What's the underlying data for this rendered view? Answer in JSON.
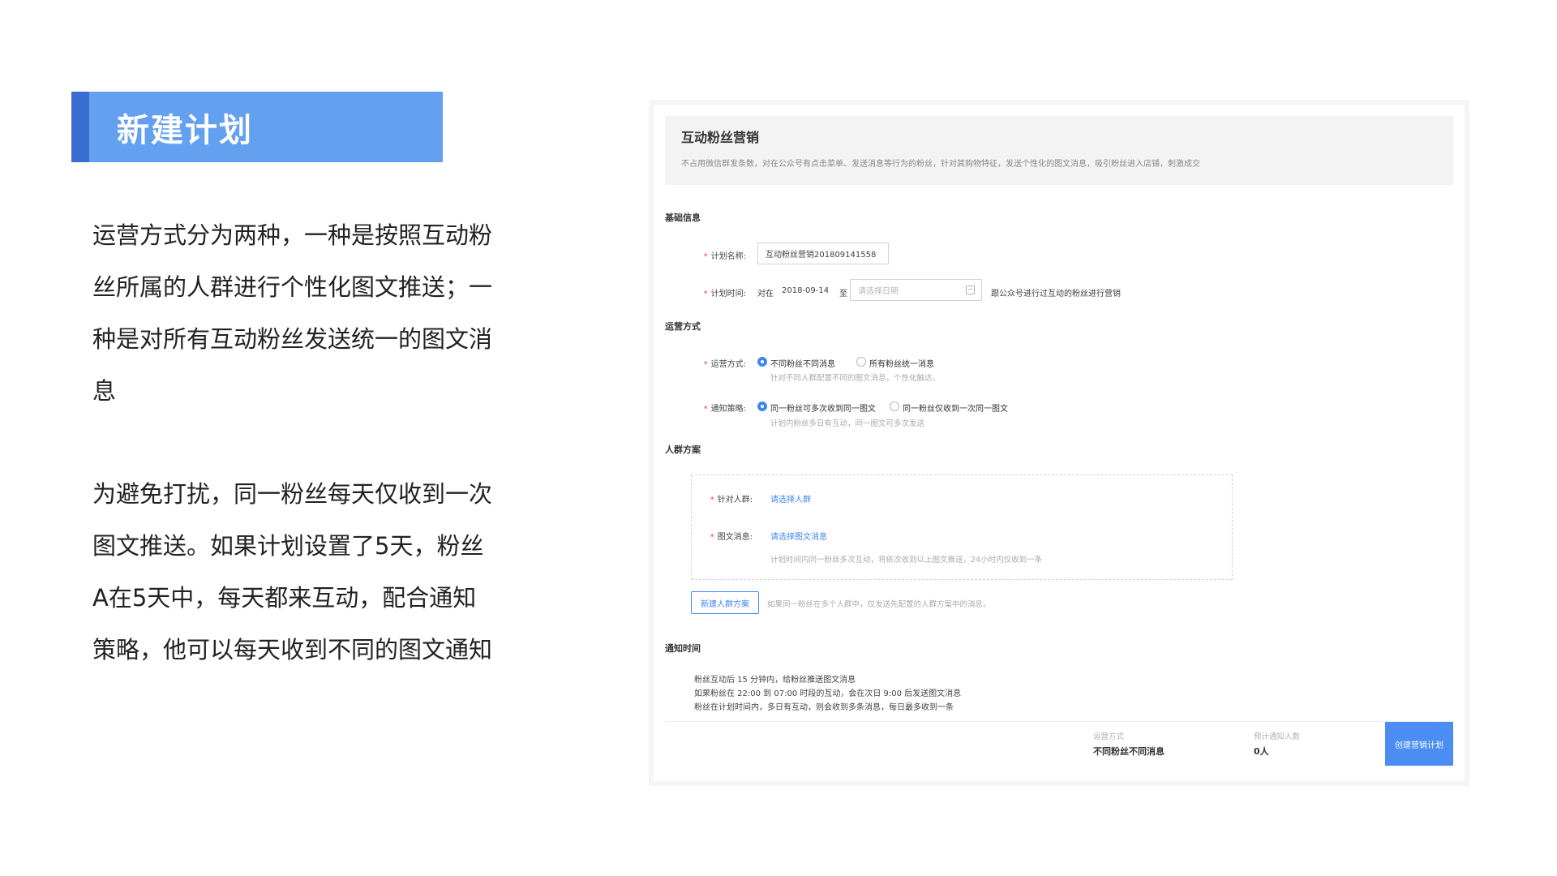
{
  "slide": {
    "title": "新建计划",
    "paragraph1_lines": [
      "运营方式分为两种，一种是按照互动粉",
      "丝所属的人群进行个性化图文推送；一",
      "种是对所有互动粉丝发送统一的图文消",
      "息"
    ],
    "paragraph2_lines": [
      "为避免打扰，同一粉丝每天仅收到一次",
      "图文推送。如果计划设置了5天，粉丝",
      "A在5天中，每天都来互动，配合通知",
      "策略，他可以每天收到不同的图文通知"
    ]
  },
  "app": {
    "header": {
      "title": "互动粉丝营销",
      "description": "不占用微信群发条数，对在公众号有点击菜单、发送消息等行为的粉丝，针对其购物特征，发送个性化的图文消息，吸引粉丝进入店铺，刺激成交"
    },
    "basic": {
      "section": "基础信息",
      "plan_name_label": "计划名称:",
      "plan_name_value": "互动粉丝营销201809141558",
      "plan_time_label": "计划时间:",
      "plan_time_prefix": "对在",
      "plan_time_start": "2018-09-14",
      "plan_time_to": "至",
      "plan_time_placeholder": "请选择日期",
      "plan_time_suffix": "跟公众号进行过互动的粉丝进行营销"
    },
    "operation": {
      "section": "运营方式",
      "mode_label": "运营方式:",
      "mode_option1": "不同粉丝不同消息",
      "mode_option2": "所有粉丝统一消息",
      "mode_hint": "针对不同人群配置不同的图文消息，个性化触达。",
      "notify_label": "通知策略:",
      "notify_option1": "同一粉丝可多次收到同一图文",
      "notify_option2": "同一粉丝仅收到一次同一图文",
      "notify_hint": "计划内粉丝多日有互动，同一图文可多次发送"
    },
    "crowd": {
      "section": "人群方案",
      "target_label": "针对人群:",
      "target_link": "请选择人群",
      "message_label": "图文消息:",
      "message_link": "请选择图文消息",
      "message_hint": "计划时间内同一粉丝多次互动，将依次收到以上图文推送，24小时内仅收到一条",
      "new_button": "新建人群方案",
      "new_hint": "如果同一粉丝在多个人群中，仅发送先配置的人群方案中的消息。"
    },
    "notify_time": {
      "section": "通知时间",
      "lines": [
        "粉丝互动后 15 分钟内，给粉丝推送图文消息",
        "如果粉丝在 22:00 到 07:00 时段的互动，会在次日 9:00 后发送图文消息",
        "粉丝在计划时间内，多日有互动，则会收到多条消息，每日最多收到一条"
      ]
    },
    "footer": {
      "mode_label": "运营方式",
      "mode_value": "不同粉丝不同消息",
      "count_label": "预计通知人数",
      "count_value": "0人",
      "create_button": "创建营销计划"
    },
    "colors": {
      "accent": "#3e86f0",
      "banner": "#64a0f0",
      "banner_bar": "#3a6fd0",
      "required": "#e0464a"
    }
  }
}
